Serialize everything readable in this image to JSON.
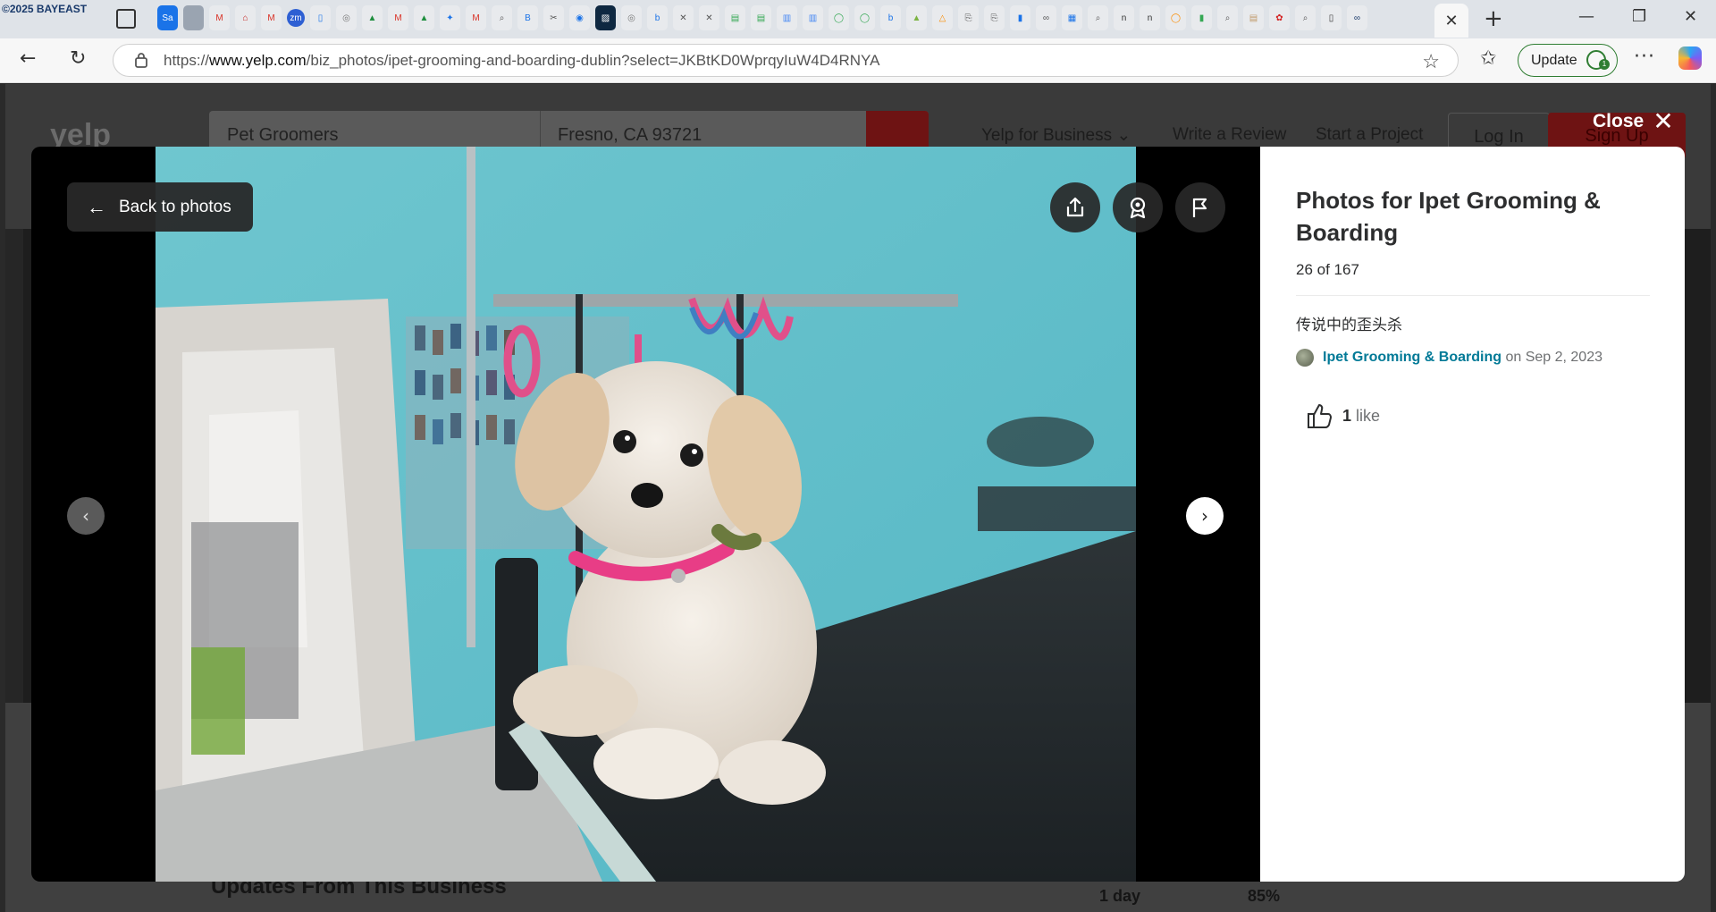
{
  "browser": {
    "watermark": "©2025 BAYEAST",
    "url_prefix": "https://",
    "url_host": "www.yelp.com",
    "url_path": "/biz_photos/ipet-grooming-and-boarding-dublin?select=JKBtKD0WprqyIuW4D4RNYA",
    "update_label": "Update",
    "update_badge": "1"
  },
  "yelp_page": {
    "logo": "yelp",
    "search_query": "Pet Groomers",
    "search_location": "Fresno, CA 93721",
    "nav_business": "Yelp for Business ⌄",
    "nav_review": "Write a Review",
    "nav_project": "Start a Project",
    "login": "Log In",
    "signup": "Sign Up",
    "updates_title": "Updates From This Business",
    "stat_1": "1 day",
    "stat_2": "85%"
  },
  "modal": {
    "close_label": "Close",
    "back_label": "Back to photos",
    "title": "Photos for Ipet Grooming & Boarding",
    "count": "26 of 167",
    "caption": "传说中的歪头杀",
    "credit_name": "Ipet Grooming & Boarding",
    "credit_date": "on Sep 2, 2023",
    "like_count": "1",
    "like_label": "like"
  },
  "colors": {
    "link": "#027a97",
    "yelp_red": "#d32323"
  },
  "icons": [
    "share-icon",
    "award-icon",
    "flag-icon",
    "chevron-left-icon",
    "chevron-right-icon",
    "thumbs-up-icon",
    "arrow-left-icon",
    "close-icon"
  ]
}
